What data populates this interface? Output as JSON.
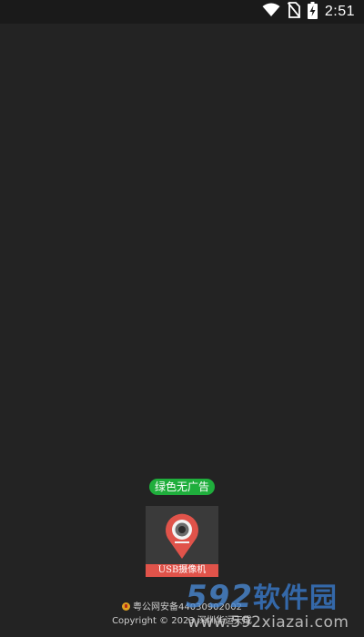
{
  "status_bar": {
    "time": "2:51",
    "icons": [
      "wifi-icon",
      "no-sim-icon",
      "battery-charging-icon"
    ]
  },
  "splash": {
    "badge": "绿色无广告",
    "app_icon_label": "USB摄像机",
    "app_icon_name": "usb-camera-app-icon"
  },
  "footer": {
    "icp": "粤公网安备44030902002",
    "copyright": "Copyright © 2023 深圳华运天成"
  },
  "watermark": {
    "brand_digits": "592",
    "brand_cn": "软件园",
    "url": "www.592xiazai.com"
  },
  "colors": {
    "background": "#232323",
    "badge": "#1fae3c",
    "icon_accent": "#e0534a"
  }
}
